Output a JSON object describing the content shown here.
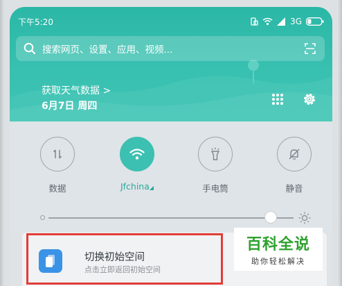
{
  "status_bar": {
    "time": "下午5:20",
    "network": "3G"
  },
  "search": {
    "placeholder": "搜索网页、设置、应用、视频..."
  },
  "weather": {
    "link": "获取天气数据 >",
    "date": "6月7日 周四"
  },
  "toggles": [
    {
      "label": "数据",
      "icon": "data-arrows-icon",
      "active": false
    },
    {
      "label": "Jfchina",
      "icon": "wifi-icon",
      "active": true
    },
    {
      "label": "手电筒",
      "icon": "flashlight-icon",
      "active": false
    },
    {
      "label": "静音",
      "icon": "mute-bell-icon",
      "active": false
    }
  ],
  "brightness": {
    "level": 0.93
  },
  "notification": {
    "title": "切换初始空间",
    "subtitle": "点击立即返回初始空间"
  },
  "watermark": {
    "brand": "百科全说",
    "tagline": "助你轻松解决"
  },
  "colors": {
    "accent": "#3cc0b1",
    "highlight_border": "#e23c37",
    "app_icon": "#3a93e6"
  }
}
